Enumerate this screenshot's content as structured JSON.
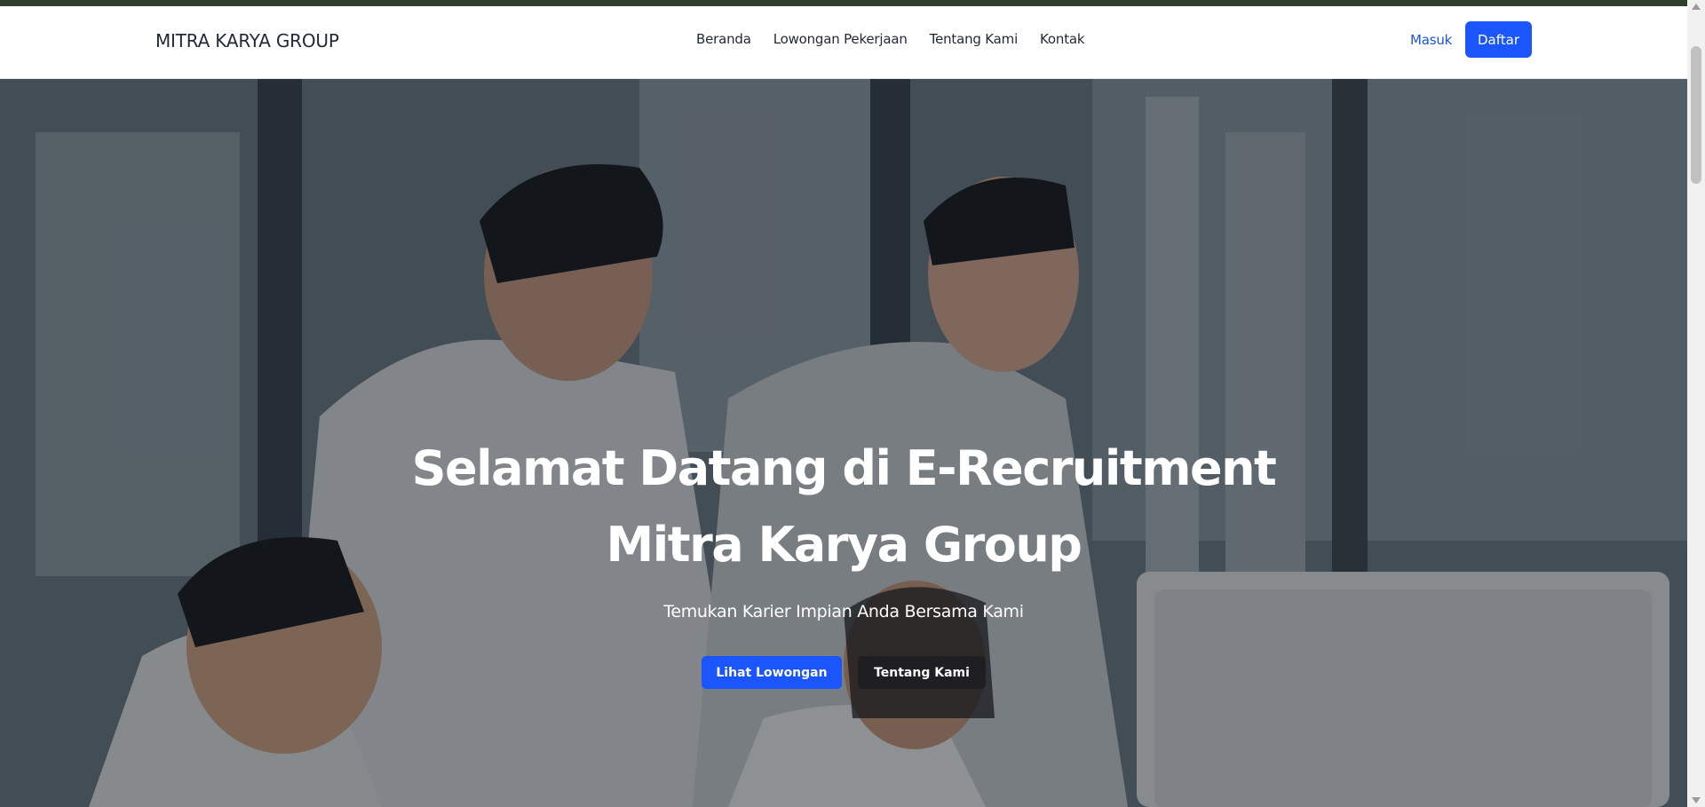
{
  "header": {
    "brand": "MITRA KARYA GROUP",
    "nav": [
      {
        "label": "Beranda"
      },
      {
        "label": "Lowongan Pekerjaan"
      },
      {
        "label": "Tentang Kami"
      },
      {
        "label": "Kontak"
      }
    ],
    "login_label": "Masuk",
    "register_label": "Daftar"
  },
  "hero": {
    "title_line1": "Selamat Datang di E-Recruitment",
    "title_line2": "Mitra Karya Group",
    "subtitle": "Temukan Karier Impian Anda Bersama Kami",
    "primary_button": "Lihat Lowongan",
    "secondary_button": "Tentang Kami",
    "background_image": "office-team-photo"
  },
  "colors": {
    "accent": "#1a56fb",
    "text_dark": "#1f2937",
    "top_strip": "#2f3f2e"
  }
}
